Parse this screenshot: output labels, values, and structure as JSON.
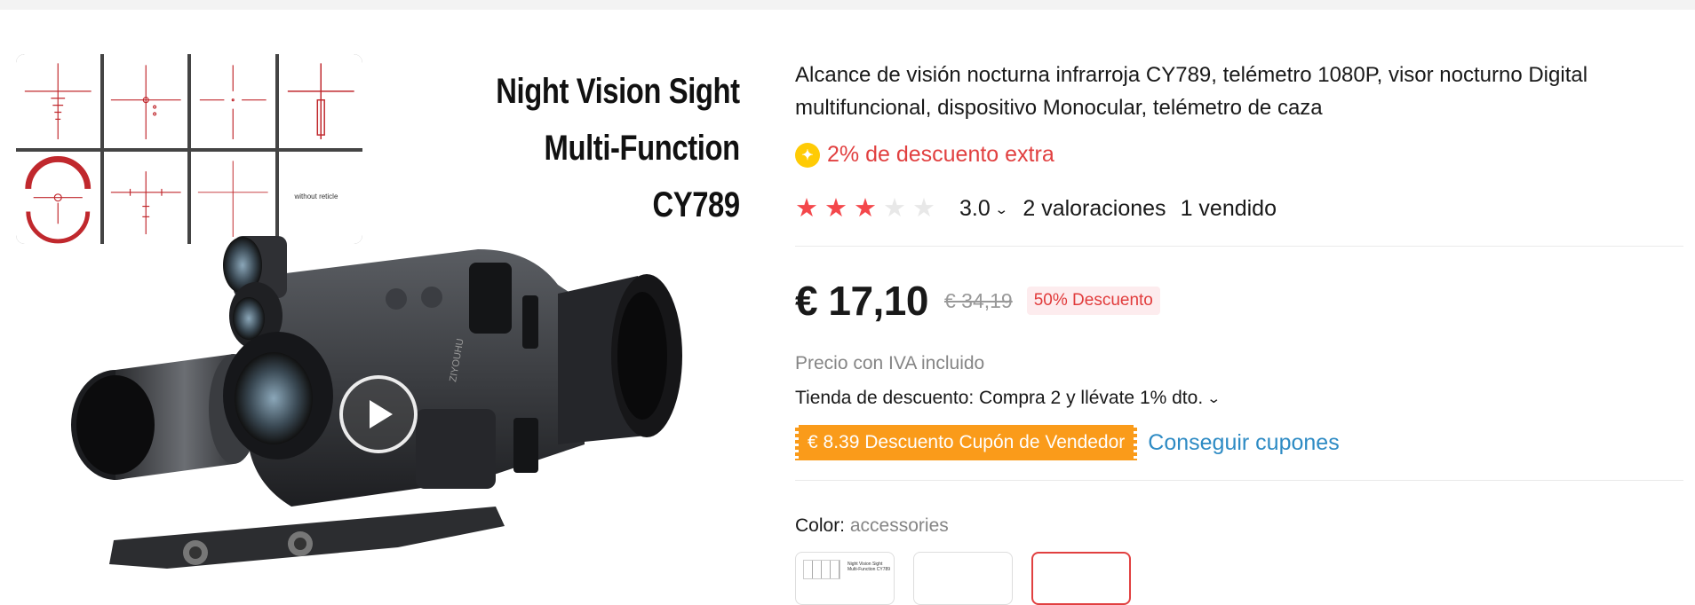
{
  "gallery": {
    "hero_title_lines": [
      "Night Vision Sight",
      "Multi-Function",
      "CY789"
    ],
    "reticle_without_label": "without reticle",
    "icons": {
      "play": "play-icon"
    }
  },
  "product": {
    "title": "Alcance de visión nocturna infrarroja CY789, telémetro 1080P, visor nocturno Digital multifuncional, dispositivo Monocular, telémetro de caza",
    "extra_discount": "2% de descuento extra",
    "rating": 3.0,
    "rating_text": "3.0",
    "reviews": "2 valoraciones",
    "sold": "1 vendido",
    "price_current": "€ 17,10",
    "price_old": "€ 34,19",
    "discount_badge": "50% Descuento",
    "tax_note": "Precio con IVA incluido",
    "store_discount": "Tienda de descuento: Compra 2 y llévate 1% dto.",
    "coupon_tag": "€ 8.39 Descuento Cupón de Vendedor",
    "get_coupons": "Conseguir cupones",
    "color_label": "Color:",
    "color_value": "accessories",
    "swatch_mini_text": "Night Vision Sight Multi-Function CY789"
  },
  "colors": {
    "accent_red": "#e14040",
    "star_red": "#f4474b",
    "coupon_orange": "#fa9b1a",
    "link_blue": "#2e8bc4",
    "coin_yellow": "#ffcb05"
  }
}
